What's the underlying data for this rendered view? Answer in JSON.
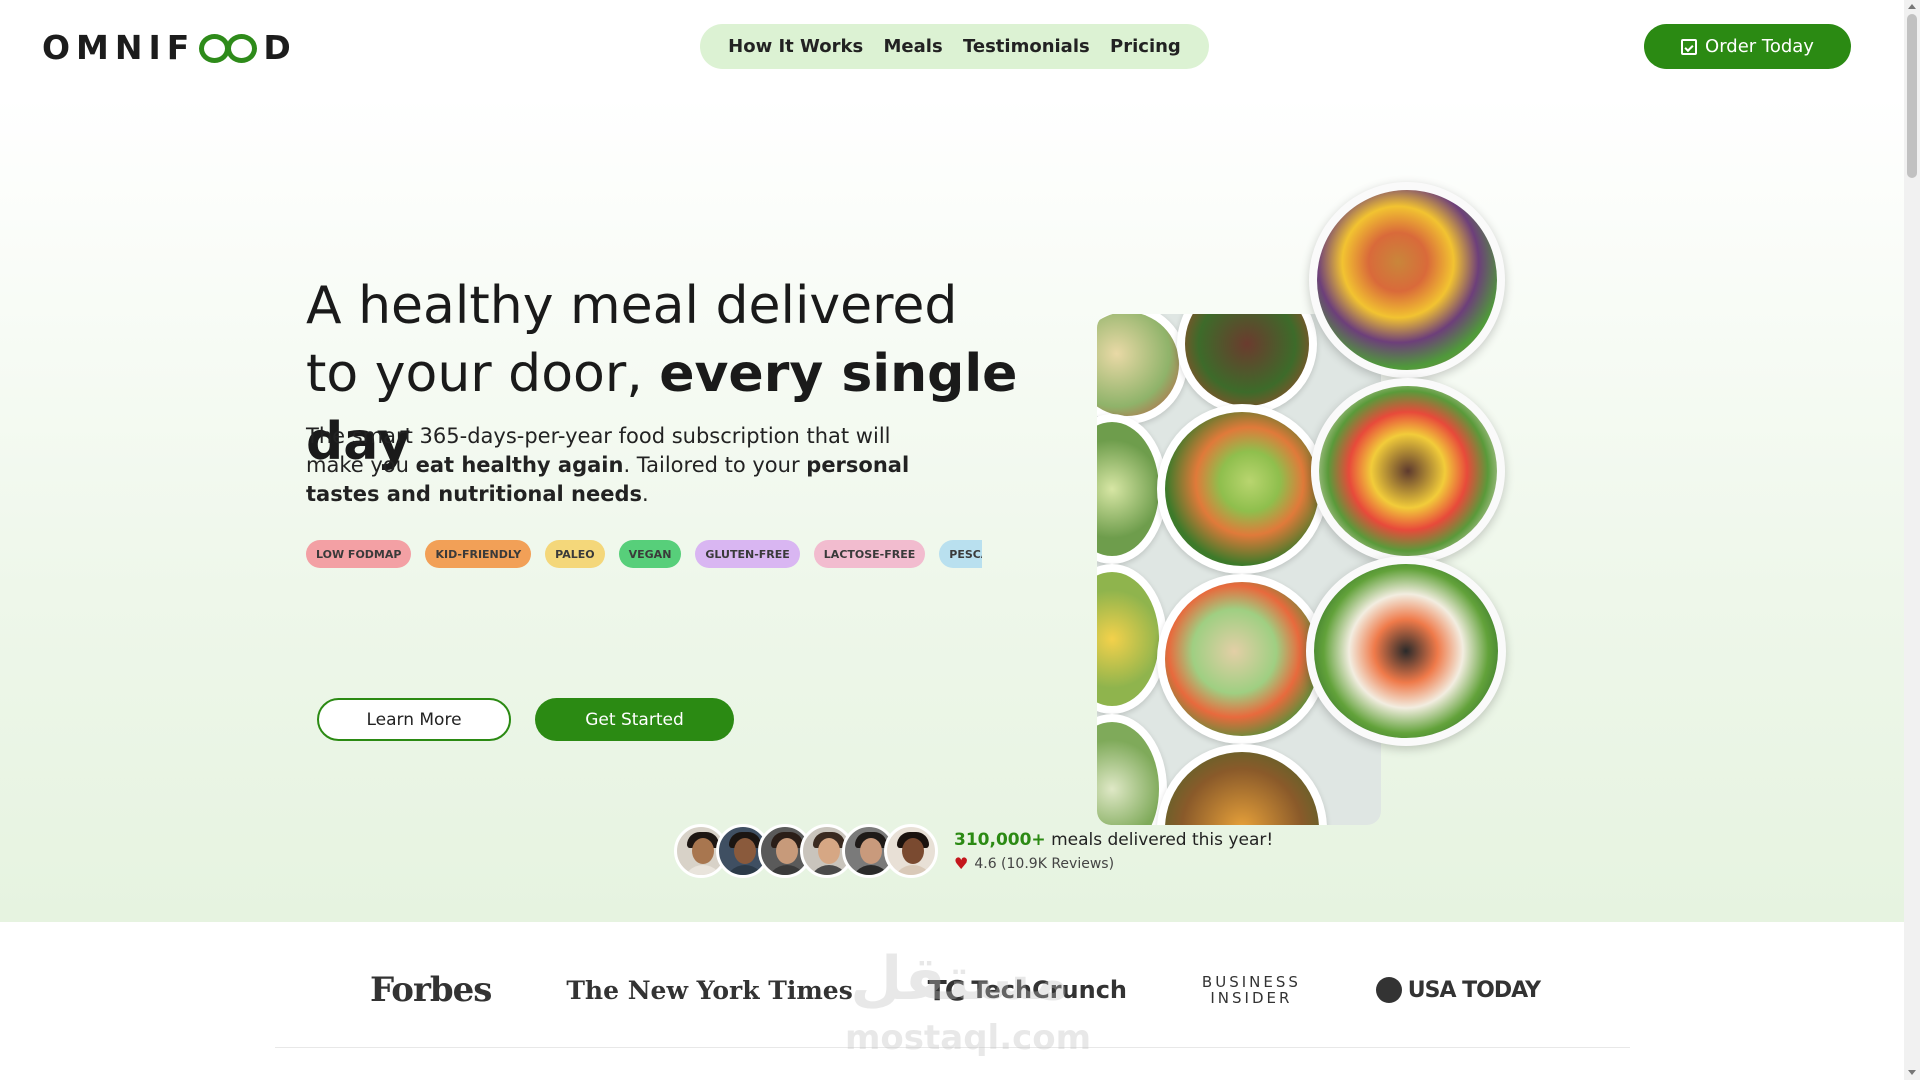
{
  "header": {
    "logo": {
      "before": "OMNIF",
      "after": "D"
    },
    "nav": [
      "How It Works",
      "Meals",
      "Testimonials",
      "Pricing"
    ],
    "cta": "Order Today",
    "cta_icon": "calendar-check-icon"
  },
  "hero": {
    "headline_plain": "A healthy meal delivered to your door, ",
    "headline_bold": "every single day",
    "lead": [
      {
        "text": "The smart 365-days-per-year food subscription that will make you ",
        "bold": false
      },
      {
        "text": "eat healthy again",
        "bold": true
      },
      {
        "text": ". Tailored to your ",
        "bold": false
      },
      {
        "text": "personal tastes and nutritional needs",
        "bold": true
      },
      {
        "text": ".",
        "bold": false
      }
    ],
    "tags": [
      {
        "label": "LOW FODMAP",
        "color": "#f3a0a4"
      },
      {
        "label": "KID-FRIENDLY",
        "color": "#f2a057"
      },
      {
        "label": "PALEO",
        "color": "#f4d77a"
      },
      {
        "label": "VEGAN",
        "color": "#57cf7a"
      },
      {
        "label": "GLUTEN-FREE",
        "color": "#d9b6f2"
      },
      {
        "label": "LACTOSE-FREE",
        "color": "#f2bccf"
      },
      {
        "label": "PESCATARIAN",
        "color": "#b9e0ef"
      }
    ],
    "learn_more": "Learn More",
    "get_started": "Get Started"
  },
  "proof": {
    "count": "310,000+",
    "count_suffix": " meals delivered this year!",
    "rating": "4.6 (10.9K Reviews)",
    "rating_icon": "heart-icon"
  },
  "featured": {
    "logos": [
      "Forbes",
      "The New York Times",
      "TechCrunch",
      "BUSINESS INSIDER",
      "USA TODAY"
    ],
    "techcrunch_mark": "TC",
    "business": "BUSINESS",
    "insider": "INSIDER"
  },
  "watermark": {
    "arabic": "مستقل",
    "latin": "mostaql.com"
  },
  "colors": {
    "brand_green": "#2b8a13",
    "nav_bg": "#dcf2d3",
    "hero_bg": "#eef7ea"
  }
}
